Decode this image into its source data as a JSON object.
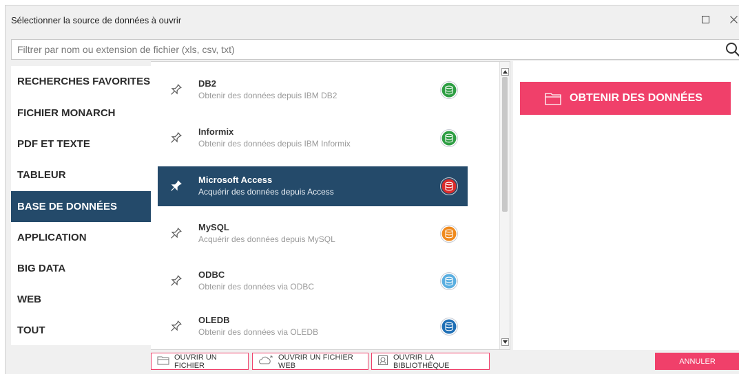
{
  "dialog": {
    "title": "Sélectionner la source de données à ouvrir",
    "maximize_icon": "maximize-icon",
    "close_icon": "close-icon"
  },
  "search": {
    "placeholder": "Filtrer par nom ou extension de fichier (xls, csv, txt)",
    "value": "",
    "icon": "search-icon"
  },
  "sidebar": {
    "items": [
      {
        "label": "RECHERCHES FAVORITES",
        "active": false
      },
      {
        "label": "FICHIER MONARCH",
        "active": false
      },
      {
        "label": "PDF ET TEXTE",
        "active": false
      },
      {
        "label": "TABLEUR",
        "active": false
      },
      {
        "label": "BASE DE DONNÉES",
        "active": true
      },
      {
        "label": "APPLICATION",
        "active": false
      },
      {
        "label": "BIG DATA",
        "active": false
      },
      {
        "label": "WEB",
        "active": false
      },
      {
        "label": "TOUT",
        "active": false
      }
    ]
  },
  "sources": [
    {
      "title": "DB2",
      "subtitle": "Obtenir des données depuis IBM DB2",
      "color": "#2e9e43",
      "selected": false
    },
    {
      "title": "Informix",
      "subtitle": "Obtenir des données depuis IBM Informix",
      "color": "#2e9e43",
      "selected": false
    },
    {
      "title": "Microsoft Access",
      "subtitle": "Acquérir des données depuis Access",
      "color": "#d92b2b",
      "selected": true
    },
    {
      "title": "MySQL",
      "subtitle": "Acquérir des données depuis MySQL",
      "color": "#ef8a1e",
      "selected": false
    },
    {
      "title": "ODBC",
      "subtitle": "Obtenir des données via ODBC",
      "color": "#5aaee0",
      "selected": false
    },
    {
      "title": "OLEDB",
      "subtitle": "Obtenir des données via OLEDB",
      "color": "#1f6fb5",
      "selected": false
    }
  ],
  "actions": {
    "get_data": "OBTENIR DES DONNÉES",
    "open_file": "OUVRIR UN FICHIER",
    "open_web_file": "OUVRIR UN FICHIER WEB",
    "open_library": "OUVRIR LA BIBLIOTHÈQUE",
    "cancel": "ANNULER"
  },
  "colors": {
    "accent": "#f0406a",
    "selected_bg": "#244a6a"
  }
}
